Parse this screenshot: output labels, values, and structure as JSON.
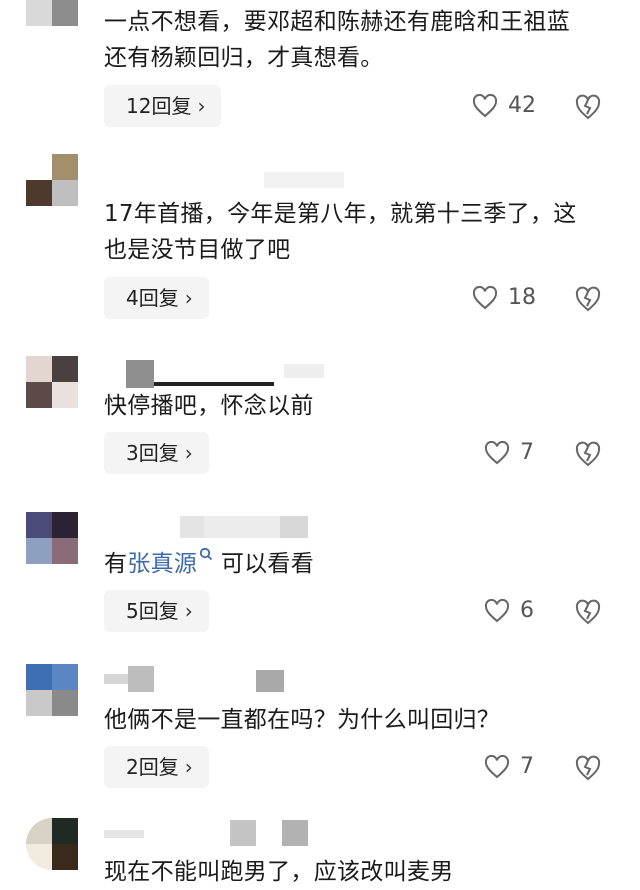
{
  "comments": [
    {
      "text_lines": [
        "一点不想看，要邓超和陈赫还有鹿晗和王祖蓝",
        "还有杨颖回归，才真想看。"
      ],
      "reply_label": "12回复",
      "likes": "42",
      "avatar_colors": [
        "#c9c9c9",
        "#6f6f6f",
        "#d9d9d9",
        "#8c8c8c"
      ]
    },
    {
      "text_lines": [
        "17年首播，今年是第八年，就第十三季了，这",
        "也是没节目做了吧"
      ],
      "reply_label": "4回复",
      "likes": "18",
      "avatar_colors": [
        "#ffffff",
        "#a38f6c",
        "#4e3a2c",
        "#bfbfbf"
      ]
    },
    {
      "text_lines": [
        "快停播吧，怀念以前"
      ],
      "reply_label": "3回复",
      "likes": "7",
      "avatar_colors": [
        "#e3d6d0",
        "#4a4040",
        "#5b4a48",
        "#e9e1de"
      ]
    },
    {
      "text_pre": "有",
      "text_link": "张真源",
      "text_post": " 可以看看",
      "reply_label": "5回复",
      "likes": "6",
      "avatar_colors": [
        "#4b4b7a",
        "#2b2233",
        "#8ea0c0",
        "#8a6b78"
      ]
    },
    {
      "text_lines": [
        "他俩不是一直都在吗？为什么叫回归？"
      ],
      "reply_label": "2回复",
      "likes": "7",
      "avatar_colors": [
        "#3e6fb4",
        "#5b86c4",
        "#c9c9c9",
        "#8a8a8a"
      ]
    },
    {
      "text_lines": [
        "现在不能叫跑男了，应该改叫麦男"
      ],
      "avatar_colors": [
        "#d8d2c6",
        "#1e2a22",
        "#f1ebe0",
        "#3a2a1c"
      ]
    }
  ],
  "icons": {
    "like": "heart-outline-icon",
    "dislike": "broken-heart-icon",
    "search": "search-icon",
    "chevron": "chevron-right-icon"
  }
}
